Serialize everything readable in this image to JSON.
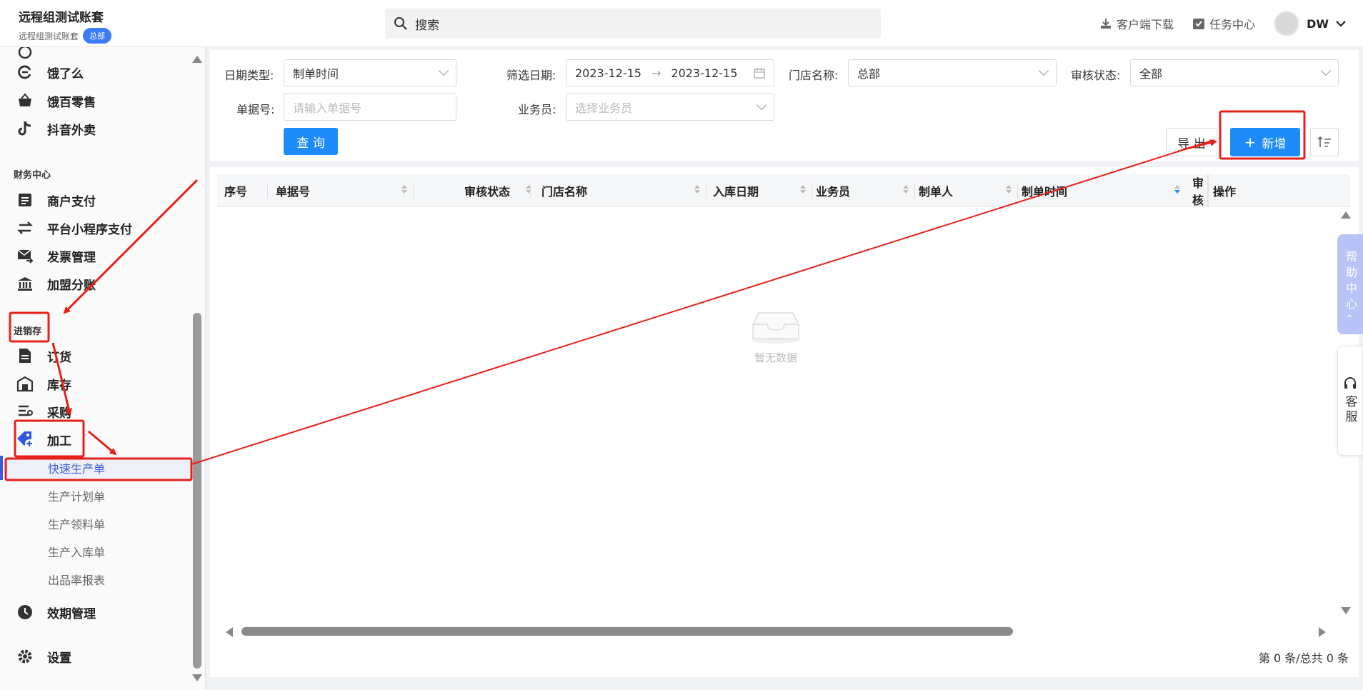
{
  "header": {
    "brand_title": "远程组测试账套",
    "brand_sub": "远程组测试账套",
    "badge": "总部",
    "search_placeholder": "搜索",
    "download": "客户端下载",
    "tasks": "任务中心",
    "user": "DW"
  },
  "sidebar": {
    "top_items": [
      {
        "label": "饿了么",
        "icon": "eleme-icon"
      },
      {
        "label": "饿百零售",
        "icon": "basket-icon"
      },
      {
        "label": "抖音外卖",
        "icon": "tiktok-icon"
      }
    ],
    "finance_label": "财务中心",
    "finance_items": [
      {
        "label": "商户支付",
        "icon": "document-icon"
      },
      {
        "label": "平台小程序支付",
        "icon": "exchange-icon"
      },
      {
        "label": "发票管理",
        "icon": "mail-send-icon"
      },
      {
        "label": "加盟分账",
        "icon": "bank-icon"
      }
    ],
    "inventory_label": "进销存",
    "inventory_items": [
      {
        "label": "订货",
        "icon": "file-icon"
      },
      {
        "label": "库存",
        "icon": "warehouse-icon"
      },
      {
        "label": "采购",
        "icon": "purchase-icon"
      },
      {
        "label": "加工",
        "icon": "tag-plus-icon"
      }
    ],
    "sub_items": [
      "快速生产单",
      "生产计划单",
      "生产领料单",
      "生产入库单",
      "出品率报表"
    ],
    "expiry": "效期管理",
    "settings": "设置"
  },
  "filters": {
    "date_type_label": "日期类型:",
    "date_type_value": "制单时间",
    "filter_date_label": "筛选日期:",
    "date_start": "2023-12-15",
    "date_arrow": "→",
    "date_end": "2023-12-15",
    "store_label": "门店名称:",
    "store_value": "总部",
    "audit_label": "审核状态:",
    "audit_value": "全部",
    "doc_no_label": "单据号:",
    "doc_no_placeholder": "请输入单据号",
    "salesman_label": "业务员:",
    "salesman_placeholder": "选择业务员",
    "query_btn": "查 询",
    "export_btn": "导 出",
    "add_btn": "新增"
  },
  "table": {
    "columns": [
      "序号",
      "单据号",
      "审核状态",
      "门店名称",
      "入库日期",
      "业务员",
      "制单人",
      "制单时间",
      "审核",
      "操作"
    ],
    "empty_text": "暂无数据"
  },
  "pagination": {
    "text": "第 0 条/总共 0 条"
  },
  "side_tabs": {
    "help": "帮助中心",
    "help_arrow": "‹",
    "service": "客服"
  },
  "colors": {
    "primary": "#1e8cf8",
    "annotation": "#e8201a",
    "active_menu": "#3a5bd9"
  }
}
